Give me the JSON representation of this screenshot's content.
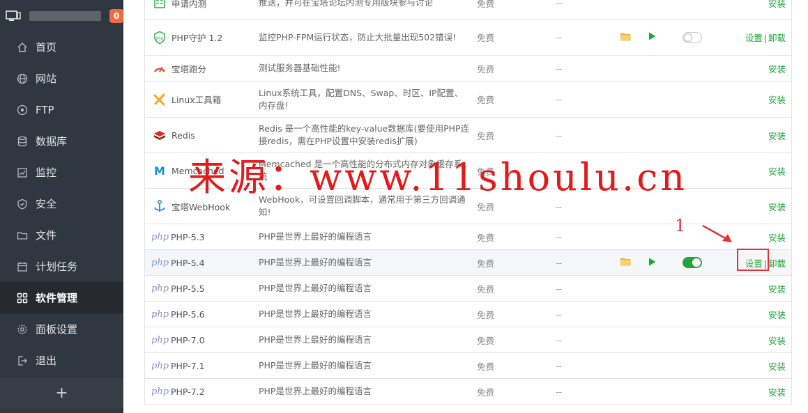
{
  "sidebar": {
    "badge": "0",
    "items": [
      {
        "label": "首页",
        "icon": "home-icon"
      },
      {
        "label": "网站",
        "icon": "globe-icon"
      },
      {
        "label": "FTP",
        "icon": "ftp-icon"
      },
      {
        "label": "数据库",
        "icon": "database-icon"
      },
      {
        "label": "监控",
        "icon": "monitor-icon"
      },
      {
        "label": "安全",
        "icon": "shield-icon"
      },
      {
        "label": "文件",
        "icon": "folder-icon"
      },
      {
        "label": "计划任务",
        "icon": "calendar-icon"
      },
      {
        "label": "软件管理",
        "icon": "grid-icon"
      },
      {
        "label": "面板设置",
        "icon": "gear-icon"
      },
      {
        "label": "退出",
        "icon": "logout-icon"
      }
    ],
    "active_index": 8,
    "add_label": "+"
  },
  "software": {
    "rows": [
      {
        "name": "申请内测",
        "desc": "推送，并可在宝塔论坛内测专用版块参与讨论",
        "price": "免费",
        "expire": "--",
        "ops": [
          "安装"
        ]
      },
      {
        "name": "PHP守护 1.2",
        "desc": "监控PHP-FPM运行状态，防止大批量出现502错误!",
        "price": "免费",
        "expire": "--",
        "ops": [
          "设置",
          "卸载"
        ],
        "controls": "off"
      },
      {
        "name": "宝塔跑分",
        "desc": "测试服务器基础性能!",
        "price": "免费",
        "expire": "--",
        "ops": [
          "安装"
        ]
      },
      {
        "name": "Linux工具箱",
        "desc": "Linux系统工具，配置DNS、Swap、时区、IP配置、内存盘!",
        "price": "免费",
        "expire": "--",
        "ops": [
          "安装"
        ]
      },
      {
        "name": "Redis",
        "desc": "Redis 是一个高性能的key-value数据库(要使用PHP连接redis，需在PHP设置中安装redis扩展)",
        "price": "免费",
        "expire": "--",
        "ops": [
          "安装"
        ]
      },
      {
        "name": "Memcached",
        "desc": "Memcached 是一个高性能的分布式内存对象缓存系统",
        "price": "免费",
        "expire": "--",
        "ops": [
          "安装"
        ]
      },
      {
        "name": "宝塔WebHook",
        "desc": "WebHook，可设置回调脚本，通常用于第三方回调通知!",
        "price": "免费",
        "expire": "--",
        "ops": [
          "安装"
        ]
      },
      {
        "name": "PHP-5.3",
        "desc": "PHP是世界上最好的编程语言",
        "price": "免费",
        "expire": "--",
        "ops": [
          "安装"
        ]
      },
      {
        "name": "PHP-5.4",
        "desc": "PHP是世界上最好的编程语言",
        "price": "免费",
        "expire": "--",
        "ops": [
          "设置",
          "卸载"
        ],
        "controls": "on"
      },
      {
        "name": "PHP-5.5",
        "desc": "PHP是世界上最好的编程语言",
        "price": "免费",
        "expire": "--",
        "ops": [
          "安装"
        ]
      },
      {
        "name": "PHP-5.6",
        "desc": "PHP是世界上最好的编程语言",
        "price": "免费",
        "expire": "--",
        "ops": [
          "安装"
        ]
      },
      {
        "name": "PHP-7.0",
        "desc": "PHP是世界上最好的编程语言",
        "price": "免费",
        "expire": "--",
        "ops": [
          "安装"
        ]
      },
      {
        "name": "PHP-7.1",
        "desc": "PHP是世界上最好的编程语言",
        "price": "免费",
        "expire": "--",
        "ops": [
          "安装"
        ]
      },
      {
        "name": "PHP-7.2",
        "desc": "PHP是世界上最好的编程语言",
        "price": "免费",
        "expire": "--",
        "ops": [
          "安装"
        ]
      }
    ],
    "php_logo_text": "php",
    "op_separator": "|"
  },
  "annotation": {
    "number": "1"
  },
  "watermark": "来源：www.11shoulu.cn",
  "colors": {
    "accent": "#20a53a",
    "annotation": "#e2313a",
    "sidebar": "#2f3740",
    "badge": "#ef6d3c"
  }
}
